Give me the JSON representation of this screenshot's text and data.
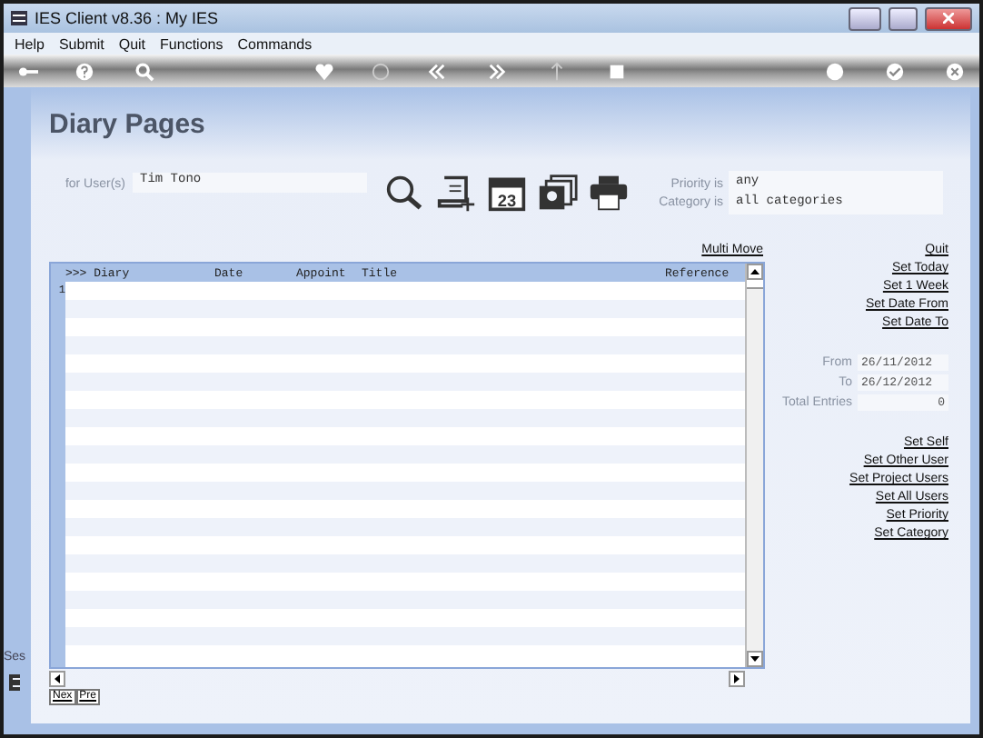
{
  "window": {
    "title": "IES Client v8.36 : My IES"
  },
  "menu": [
    "Help",
    "Submit",
    "Quit",
    "Functions",
    "Commands"
  ],
  "page": {
    "title": "Diary Pages"
  },
  "filters": {
    "user_label": "for User(s)",
    "user": "Tim Tono",
    "priority_label": "Priority is",
    "priority": "any",
    "category_label": "Category is",
    "category": "all categories"
  },
  "calendar_icon_day": "23",
  "multi_move": "Multi Move",
  "table": {
    "columns": [
      ">>> Diary",
      "Date",
      "Appoint",
      "Title",
      "Reference"
    ],
    "rows": [
      {
        "number": "1"
      }
    ]
  },
  "actions": [
    "Quit",
    "Set Today",
    "Set 1 Week",
    "Set Date From",
    "Set Date To"
  ],
  "range": {
    "from_label": "From",
    "from": "26/11/2012",
    "to_label": "To",
    "to": "26/12/2012",
    "total_label": "Total Entries",
    "total": "0"
  },
  "user_actions": [
    "Set Self",
    "Set Other User",
    "Set Project Users",
    "Set All Users",
    "Set Priority",
    "Set Category"
  ],
  "side": {
    "label": "Ses"
  },
  "pager": [
    "Nex",
    "Pre"
  ]
}
